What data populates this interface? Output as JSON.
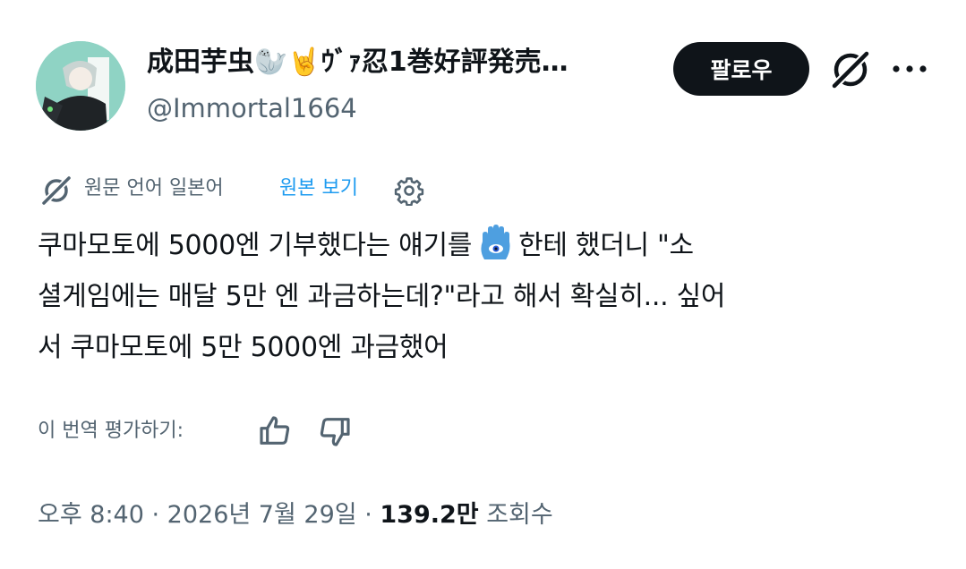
{
  "author": {
    "display_name": "成田芋虫🦭🤘ｳﾞｧ忍1巻好評発売…",
    "handle": "@Immortal1664"
  },
  "actions": {
    "follow_label": "팔로우"
  },
  "translation": {
    "source_label": "원문 언어 일본어",
    "view_original": "원본 보기"
  },
  "tweet": {
    "line1_before": "쿠마모토에 5000엔 기부했다는 얘기를",
    "line1_after": "한테 했더니 \"소",
    "line2": "셜게임에는 매달 5만 엔 과금하는데?\"라고 해서 확실히... 싶어",
    "line3": "서 쿠마모토에 5만 5000엔 과금했어"
  },
  "rating": {
    "label": "이 번역 평가하기:"
  },
  "meta": {
    "time": "오후 8:40",
    "date": "2026년 7월 29일",
    "views_count": "139.2만",
    "views_label": "조회수"
  },
  "icons": {
    "grok": "grok-icon",
    "more": "more-horizontal-icon",
    "translate": "grok-translate-icon",
    "settings": "gear-icon",
    "thumb_up": "thumbs-up-icon",
    "thumb_down": "thumbs-down-icon",
    "hamsa": "hamsa-emoji"
  },
  "colors": {
    "text": "#0f1419",
    "secondary": "#536471",
    "link": "#1d9bf0",
    "button_bg": "#0f1419"
  }
}
